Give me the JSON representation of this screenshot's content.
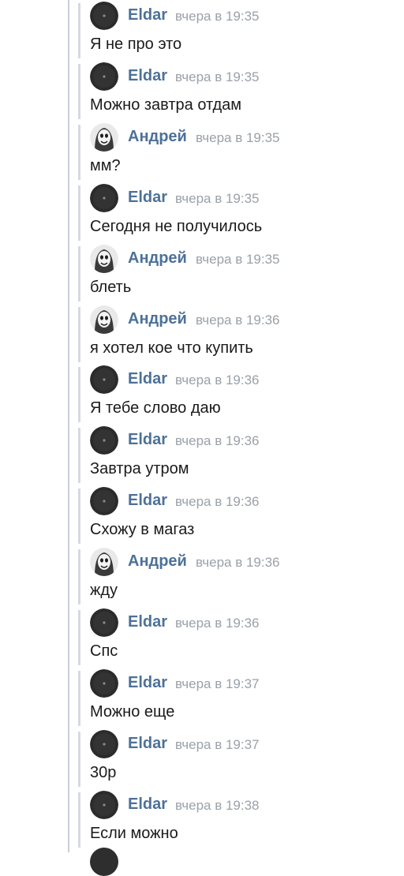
{
  "messages": [
    {
      "author": "Eldar",
      "time": "вчера в 19:35",
      "text": "Я не про это"
    },
    {
      "author": "Eldar",
      "time": "вчера в 19:35",
      "text": "Можно завтра отдам"
    },
    {
      "author": "Андрей",
      "time": "вчера в 19:35",
      "text": "мм?"
    },
    {
      "author": "Eldar",
      "time": "вчера в 19:35",
      "text": "Сегодня не получилось"
    },
    {
      "author": "Андрей",
      "time": "вчера в 19:35",
      "text": "блеть"
    },
    {
      "author": "Андрей",
      "time": "вчера в 19:36",
      "text": "я хотел кое что купить"
    },
    {
      "author": "Eldar",
      "time": "вчера в 19:36",
      "text": "Я тебе слово даю"
    },
    {
      "author": "Eldar",
      "time": "вчера в 19:36",
      "text": "Завтра утром"
    },
    {
      "author": "Eldar",
      "time": "вчера в 19:36",
      "text": "Схожу в магаз"
    },
    {
      "author": "Андрей",
      "time": "вчера в 19:36",
      "text": "жду"
    },
    {
      "author": "Eldar",
      "time": "вчера в 19:36",
      "text": "Спс"
    },
    {
      "author": "Eldar",
      "time": "вчера в 19:37",
      "text": "Можно еще"
    },
    {
      "author": "Eldar",
      "time": "вчера в 19:37",
      "text": "30р"
    },
    {
      "author": "Eldar",
      "time": "вчера в 19:38",
      "text": "Если можно"
    }
  ],
  "colors": {
    "author_name": "#4d7198",
    "timestamp": "#9aa1a9",
    "message_text": "#1a1a1a",
    "thread_line": "#c9ced6"
  },
  "icons": {
    "eldar_avatar": "dark-avatar-icon",
    "andrey_avatar": "mask-face-avatar-icon"
  }
}
